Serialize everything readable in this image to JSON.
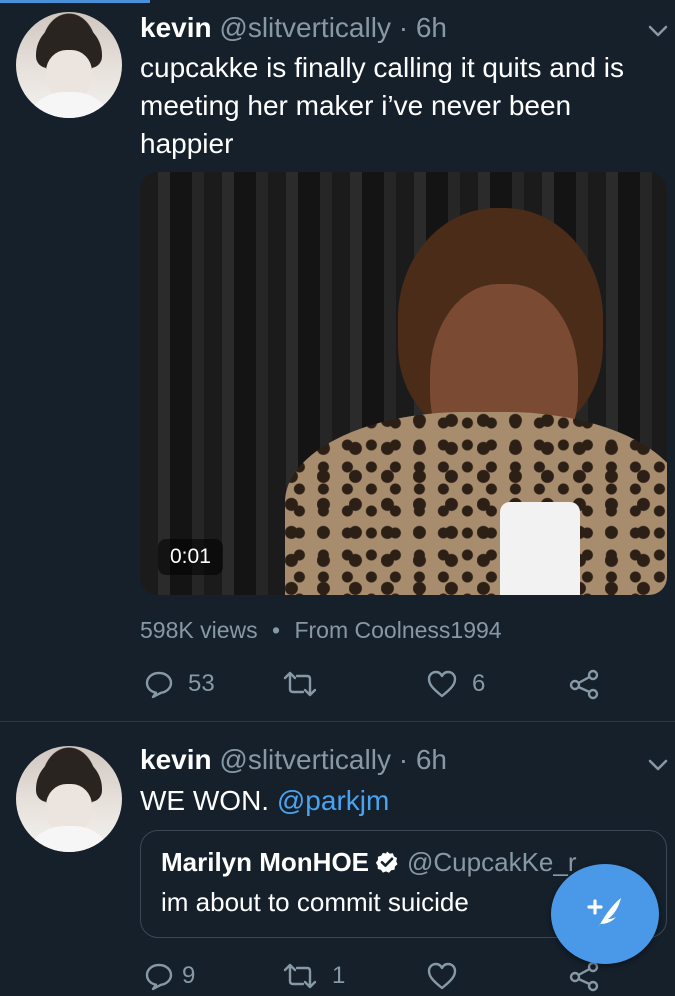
{
  "colors": {
    "background": "#15202b",
    "muted_text": "#8899a6",
    "accent": "#4a99e9",
    "mention": "#4aa3f0"
  },
  "tweets": [
    {
      "name": "kevin",
      "handle": "@slitvertically",
      "separator": "·",
      "time": "6h",
      "text": "cupcakke is finally calling it quits and is meeting her maker i’ve never been happier",
      "video": {
        "timestamp": "0:01"
      },
      "meta": {
        "views": "598K views",
        "separator": "•",
        "source": "From Coolness1994"
      },
      "actions": {
        "reply_count": "53",
        "retweet_count": "",
        "like_count": "6"
      }
    },
    {
      "name": "kevin",
      "handle": "@slitvertically",
      "separator": "·",
      "time": "6h",
      "text": "WE WON.",
      "mention": "@parkjm",
      "quote": {
        "name": "Marilyn MonHOE",
        "handle": "@CupcakKe_r",
        "text": "im about to commit suicide"
      },
      "actions": {
        "reply_count": "9",
        "retweet_count": "1",
        "like_count": ""
      }
    }
  ],
  "icons": {
    "chevron": "chevron-down-icon",
    "reply": "reply-icon",
    "retweet": "retweet-icon",
    "like": "heart-icon",
    "share": "share-icon",
    "verified": "verified-badge-icon",
    "compose": "compose-tweet-icon"
  }
}
